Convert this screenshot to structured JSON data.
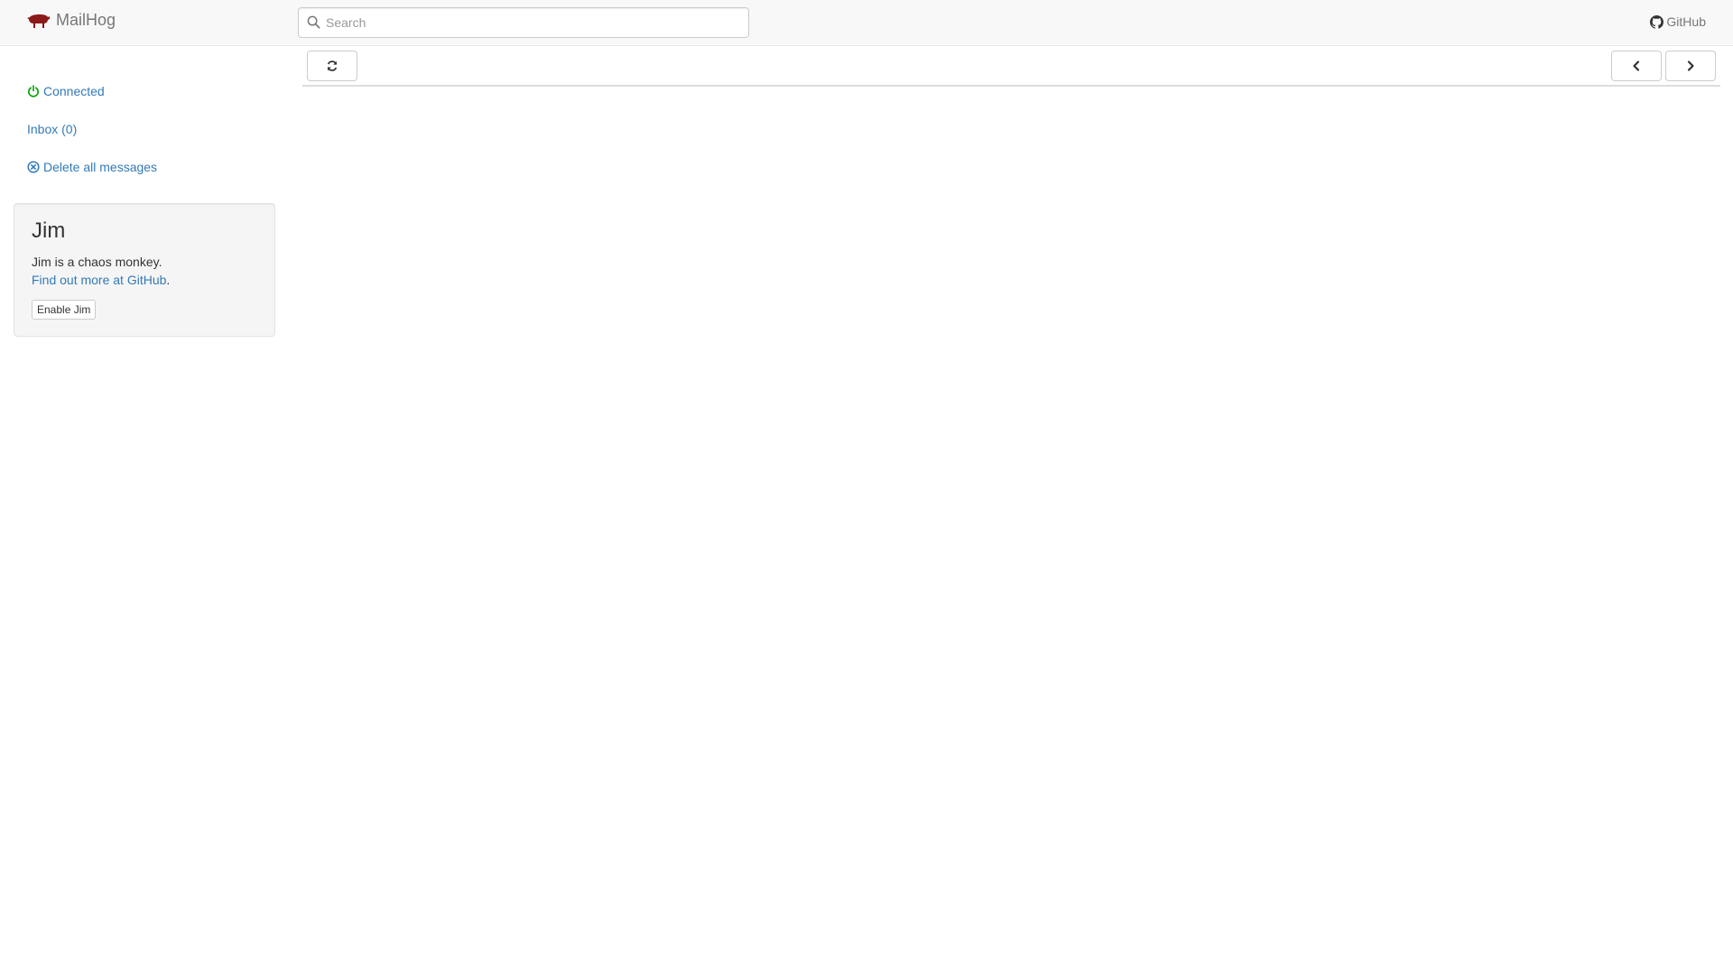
{
  "navbar": {
    "brand": "MailHog",
    "brand_logo_icon": "pig-logo-icon",
    "search": {
      "placeholder": "Search",
      "value": "",
      "icon": "search-icon"
    },
    "github": {
      "label": "GitHub",
      "icon": "github-icon"
    }
  },
  "sidebar": {
    "connected": {
      "label": "Connected",
      "icon": "power-icon",
      "color": "#00a000"
    },
    "inbox": {
      "label": "Inbox (0)"
    },
    "delete_all": {
      "label": "Delete all messages",
      "icon": "close-circle-icon"
    }
  },
  "jim": {
    "title": "Jim",
    "description": "Jim is a chaos monkey.",
    "link_text": "Find out more at GitHub",
    "link_suffix": ".",
    "button_label": "Enable Jim"
  },
  "toolbar": {
    "refresh_icon": "refresh-icon",
    "prev_icon": "chevron-left-icon",
    "next_icon": "chevron-right-icon"
  },
  "colors": {
    "link": "#337ab7",
    "navbar_bg": "#f8f8f8",
    "brand_logo": "#8b1a1a",
    "connected": "#00a000"
  }
}
